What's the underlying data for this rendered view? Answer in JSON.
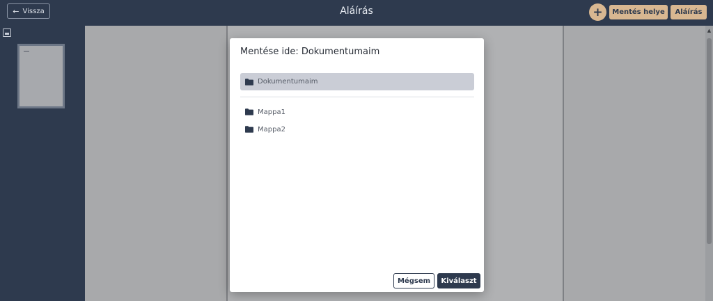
{
  "header": {
    "back_label": "Vissza",
    "title": "Aláírás",
    "add_label": "+",
    "save_location_label": "Mentés helye",
    "sign_label": "Aláírás"
  },
  "dialog": {
    "title": "Mentése ide: Dokumentumaim",
    "root_folder": "Dokumentumaim",
    "folders": [
      "Mappa1",
      "Mappa2"
    ],
    "cancel_label": "Mégsem",
    "select_label": "Kiválaszt"
  },
  "colors": {
    "header_bg": "#2e3a4e",
    "accent_beige": "#d8b791",
    "selected_folder_bg": "#cacdd6"
  }
}
